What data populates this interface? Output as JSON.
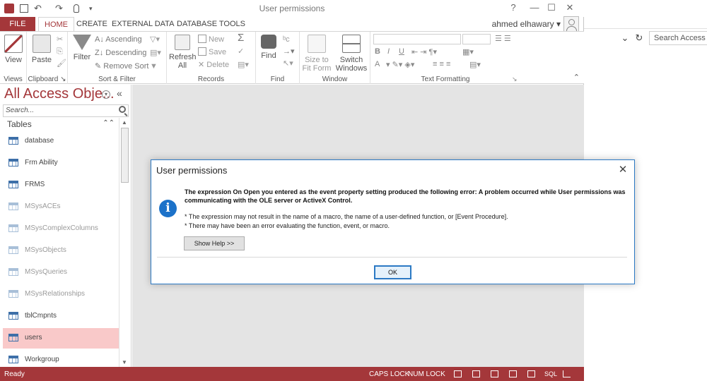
{
  "window": {
    "title": "User permissions",
    "user_name": "ahmed elhawary",
    "user_name_caret": "▾",
    "help_btn": "?",
    "ribbon_opt_btn": "⊟",
    "minimize_btn": "—",
    "maximize_btn": "☐",
    "close_btn": "✕"
  },
  "quick_access": {
    "undo": "↶",
    "redo": "↷",
    "customize": "▾"
  },
  "ribbon_tabs": [
    {
      "label": "FILE"
    },
    {
      "label": "HOME"
    },
    {
      "label": "CREATE"
    },
    {
      "label": "EXTERNAL DATA"
    },
    {
      "label": "DATABASE TOOLS"
    }
  ],
  "ribbon": {
    "views": {
      "button": "View",
      "label": "Views"
    },
    "clipboard": {
      "paste": "Paste",
      "label": "Clipboard",
      "launcher": "↘"
    },
    "sort_filter": {
      "filter": "Filter",
      "ascending": "Ascending",
      "descending": "Descending",
      "remove_sort": "Remove Sort",
      "label": "Sort & Filter"
    },
    "records": {
      "refresh": "Refresh",
      "refresh_all": "All",
      "new": "New",
      "save": "Save",
      "delete": "Delete",
      "label": "Records"
    },
    "find": {
      "find": "Find",
      "label": "Find"
    },
    "window": {
      "size_to_fit_1": "Size to",
      "size_to_fit_2": "Fit Form",
      "switch_1": "Switch",
      "switch_2": "Windows",
      "label": "Window"
    },
    "text_formatting": {
      "bold": "B",
      "italic": "I",
      "underline": "U",
      "font_color": "A",
      "label": "Text Formatting",
      "launcher": "↘"
    },
    "collapse": "⌃"
  },
  "nav": {
    "title": "All Access Obje...",
    "collapse": "«",
    "search_placeholder": "Search...",
    "section": "Tables",
    "section_chevron": "⌃⌃",
    "items": [
      {
        "label": "database"
      },
      {
        "label": "Frm Ability"
      },
      {
        "label": "FRMS"
      },
      {
        "label": "MSysACEs"
      },
      {
        "label": "MSysComplexColumns"
      },
      {
        "label": "MSysObjects"
      },
      {
        "label": "MSysQueries"
      },
      {
        "label": "MSysRelationships"
      },
      {
        "label": "tblCmpnts"
      },
      {
        "label": "users"
      },
      {
        "label": "Workgroup"
      }
    ]
  },
  "status": {
    "text": "Ready",
    "caps": "CAPS LOCK",
    "num": "NUM LOCK",
    "sql": "SQL"
  },
  "dialog": {
    "title": "User permissions",
    "close": "✕",
    "icon": "i",
    "message": "The expression On Open you entered as the event property setting produced the following error: A problem occurred while User permissions was communicating with the OLE server or ActiveX Control.",
    "detail1": "* The expression may not result in the name of a macro, the name of a user-defined function, or [Event Procedure].",
    "detail2": "* There may have been an error evaluating the function, event, or macro.",
    "help_button": "Show Help >>",
    "ok_button": "OK"
  },
  "background_window": {
    "search_placeholder": "Search Access Lo",
    "refresh": "↻",
    "dropdown": "⌄",
    "close": "✕"
  },
  "colors": {
    "accent": "#a4373a",
    "dialog_border": "#2b79c4",
    "info_icon": "#1c72c9",
    "selected_item": "#f9c9c9"
  }
}
